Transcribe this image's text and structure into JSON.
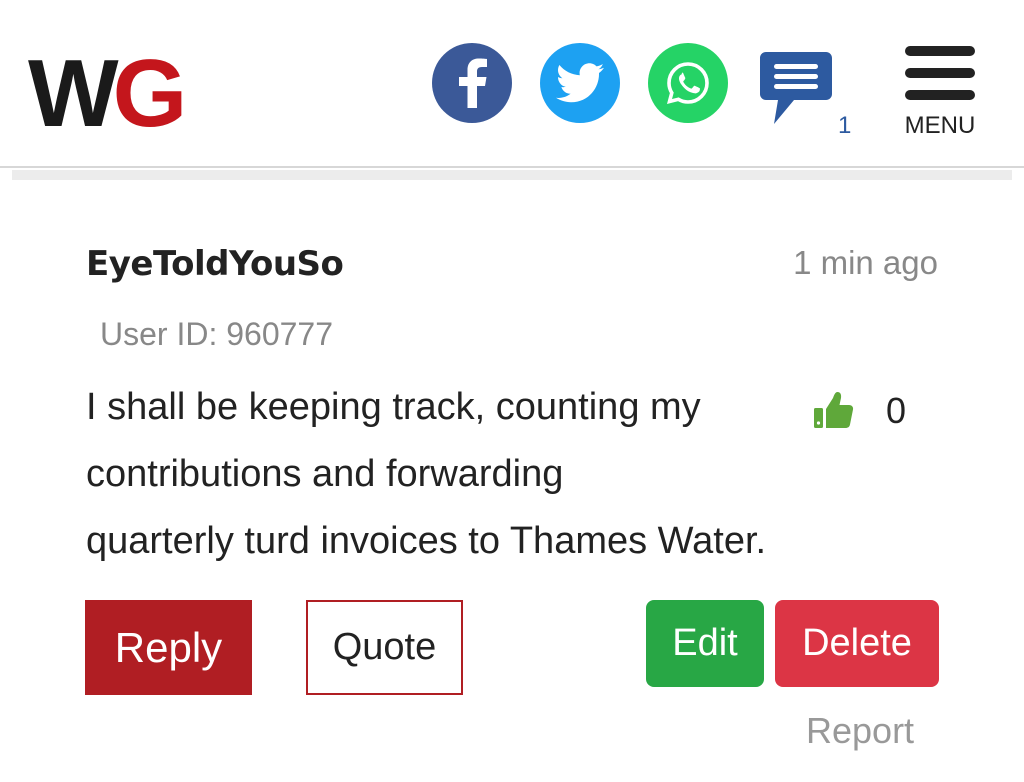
{
  "header": {
    "logo_w": "W",
    "logo_g": "G",
    "comment_count": "1",
    "menu_label": "MENU",
    "colors": {
      "facebook": "#3b5998",
      "twitter": "#1da1f2",
      "whatsapp": "#25d366",
      "comments": "#2d5aa0",
      "logo_red": "#c4161c"
    },
    "icons": [
      "facebook-icon",
      "twitter-icon",
      "whatsapp-icon",
      "comments-icon",
      "hamburger-menu-icon"
    ]
  },
  "comment": {
    "username": "EyeToldYouSo",
    "timestamp": "1 min ago",
    "user_id": "User ID: 960777",
    "body_lines": [
      "I shall be keeping track, counting my",
      "contributions and forwarding",
      "quarterly turd invoices to Thames Water."
    ],
    "likes": "0",
    "like_icon": "thumbs-up-icon",
    "like_color": "#5fa83a"
  },
  "actions": {
    "reply": "Reply",
    "quote": "Quote",
    "edit": "Edit",
    "delete": "Delete",
    "report": "Report",
    "colors": {
      "reply": "#b01e23",
      "edit": "#28a745",
      "delete": "#dc3545"
    }
  }
}
